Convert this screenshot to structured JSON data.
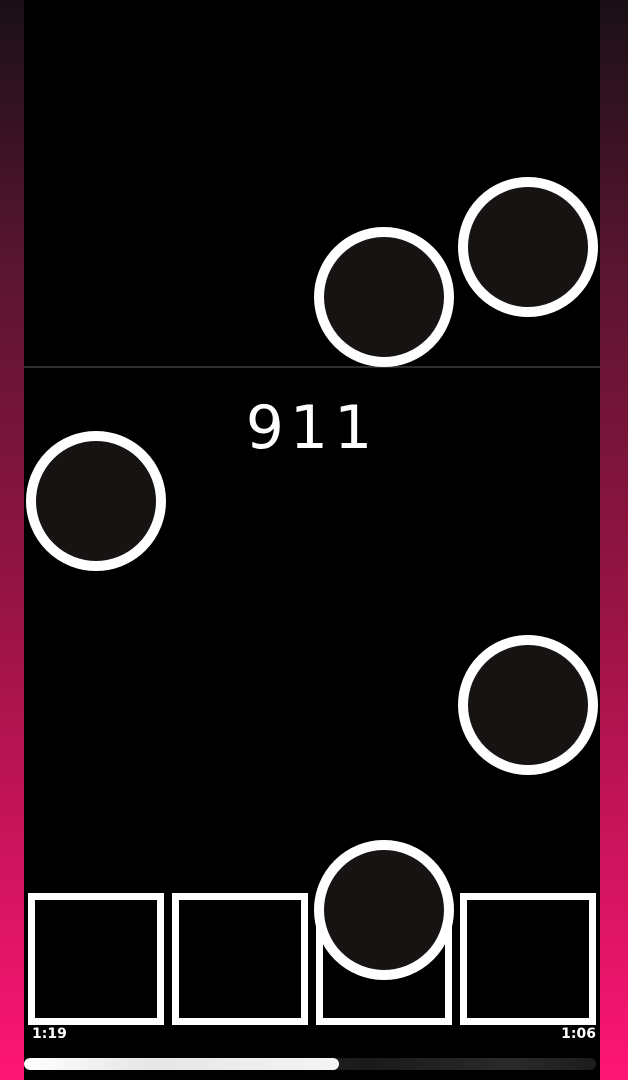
{
  "game": {
    "score": "911",
    "time_elapsed": "1:19",
    "time_remaining": "1:06",
    "song_progress": 0.55
  },
  "lanes": {
    "count": 4
  },
  "notes": [
    {
      "lane": 3,
      "state": "falling"
    },
    {
      "lane": 4,
      "state": "falling"
    },
    {
      "lane": 1,
      "state": "falling"
    },
    {
      "lane": 4,
      "state": "falling"
    },
    {
      "lane": 3,
      "state": "at-hit-zone"
    }
  ],
  "colors": {
    "background": "#000000",
    "side_gradient_top": "#1a1016",
    "side_gradient_bottom": "#ff1575",
    "note_fill": "#181313",
    "note_border": "#ffffff",
    "key_border": "#ffffff",
    "text": "#ffffff"
  }
}
